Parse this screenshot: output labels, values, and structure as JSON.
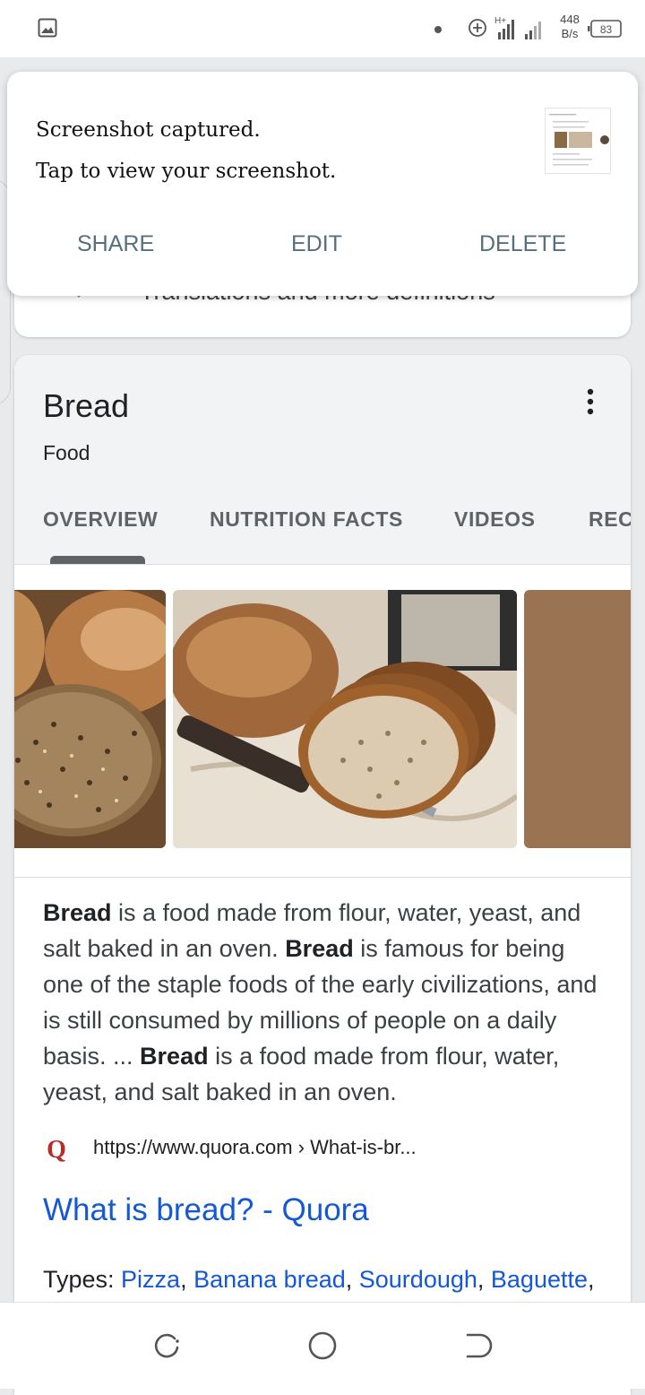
{
  "status_bar": {
    "icons": [
      "gallery-icon",
      "dot-icon",
      "data-saver-icon",
      "signal-icon",
      "battery-icon"
    ],
    "network_type": "H+",
    "speed_value": "448",
    "speed_unit": "B/s",
    "battery": "83"
  },
  "notification": {
    "line1": "Screenshot captured.",
    "line2": "Tap to view your screenshot.",
    "actions": {
      "share": "SHARE",
      "edit": "EDIT",
      "delete": "DELETE"
    }
  },
  "background_card": {
    "text": "Translations and more definitions"
  },
  "knowledge_panel": {
    "title": "Bread",
    "subtitle": "Food",
    "tabs": [
      "OVERVIEW",
      "NUTRITION FACTS",
      "VIDEOS",
      "REC"
    ],
    "selected_tab": "OVERVIEW",
    "description": {
      "bold": "Bread",
      "part1": " is a food made from flour, water, yeast, and salt baked in an oven. ",
      "part2": " is famous for being one of the staple foods of the early civilizations, and is still consumed by millions of people on a daily basis. ... ",
      "part3": " is a food made from flour, water, yeast, and salt baked in an oven."
    },
    "source": {
      "icon": "quora-icon",
      "url": "https://www.quora.com › What-is-br...",
      "link_title": "What is bread? - Quora"
    },
    "types": {
      "label": "Types: ",
      "items": [
        "Pizza",
        "Banana bread",
        "Sourdough",
        "Baguette"
      ],
      "separator": ", ",
      "trailing": ","
    }
  },
  "nav_bar": {
    "buttons": [
      "recents-button",
      "home-button",
      "back-button"
    ]
  },
  "colors": {
    "link": "#1558d6",
    "notification_action": "#556f7f",
    "panel_header_bg": "#f1f3f4",
    "bread_placeholder": "#9a7452"
  }
}
